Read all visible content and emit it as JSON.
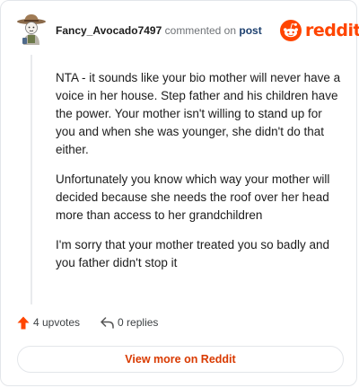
{
  "header": {
    "username": "Fancy_Avocado7497",
    "commented_text": "commented on",
    "post_link": "post",
    "logo_word": "reddit"
  },
  "comment": {
    "paragraphs": [
      "NTA - it sounds like your bio mother will never have a voice in her house. Step father and his children have the power. Your mother isn't willing to stand up for you and when she was younger, she didn't do that either.",
      "Unfortunately you know which way your mother will decided because she needs the roof over her head more than access to her grandchildren",
      "I'm sorry that your mother treated you so badly and you father didn't stop it"
    ]
  },
  "actions": {
    "upvotes": "4 upvotes",
    "replies": "0 replies"
  },
  "footer": {
    "view_more": "View more on Reddit"
  },
  "colors": {
    "brand": "#ff4500",
    "upvote": "#ff4500",
    "view_more_text": "#d93a00",
    "post_link": "#1c3f6e"
  },
  "icons": {
    "avatar": "cowboy-avatar",
    "logo": "reddit-snoo-icon",
    "upvote": "upvote-arrow-icon",
    "reply": "reply-arrow-icon"
  }
}
